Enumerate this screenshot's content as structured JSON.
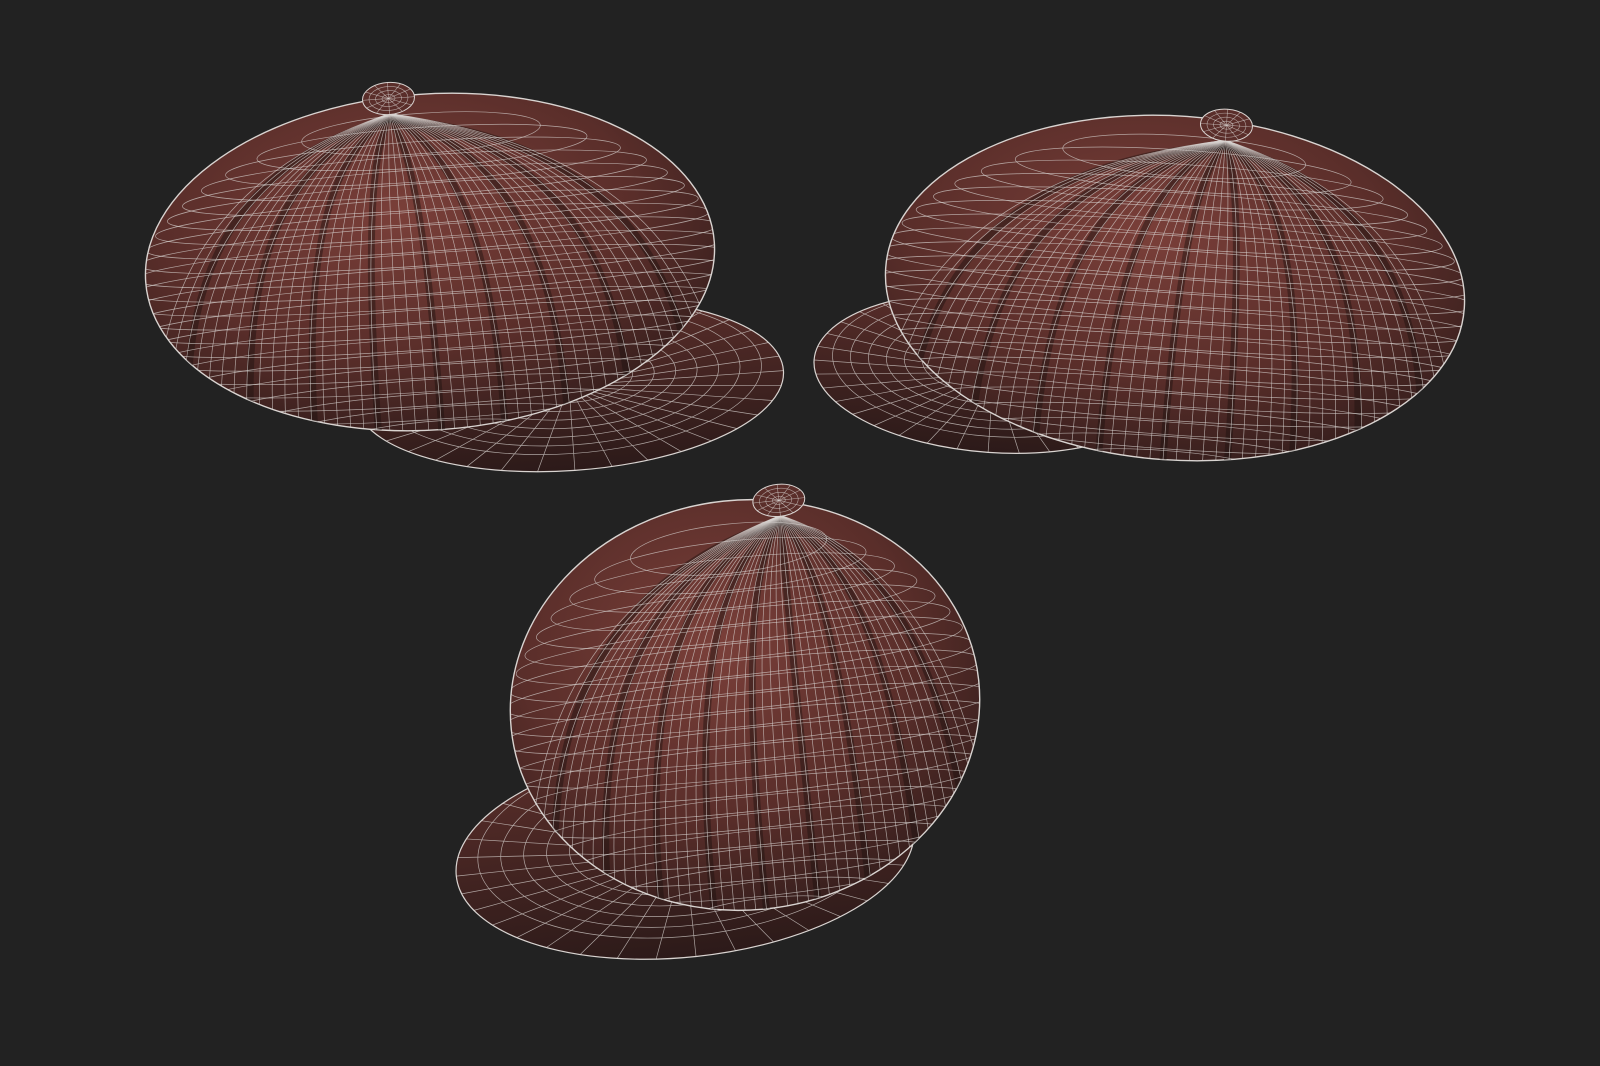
{
  "scene": {
    "background": "#222222",
    "leather_dark": "#2c1a19",
    "leather_mid": "#5a2e2a",
    "leather_light": "#7a3f39",
    "wire_color": "#d9d4d1",
    "seam_color": "#1c1110"
  },
  "models": [
    {
      "name": "cap-view-left",
      "facing": "front-right"
    },
    {
      "name": "cap-view-right",
      "facing": "front-left"
    },
    {
      "name": "cap-view-front",
      "facing": "front"
    }
  ]
}
